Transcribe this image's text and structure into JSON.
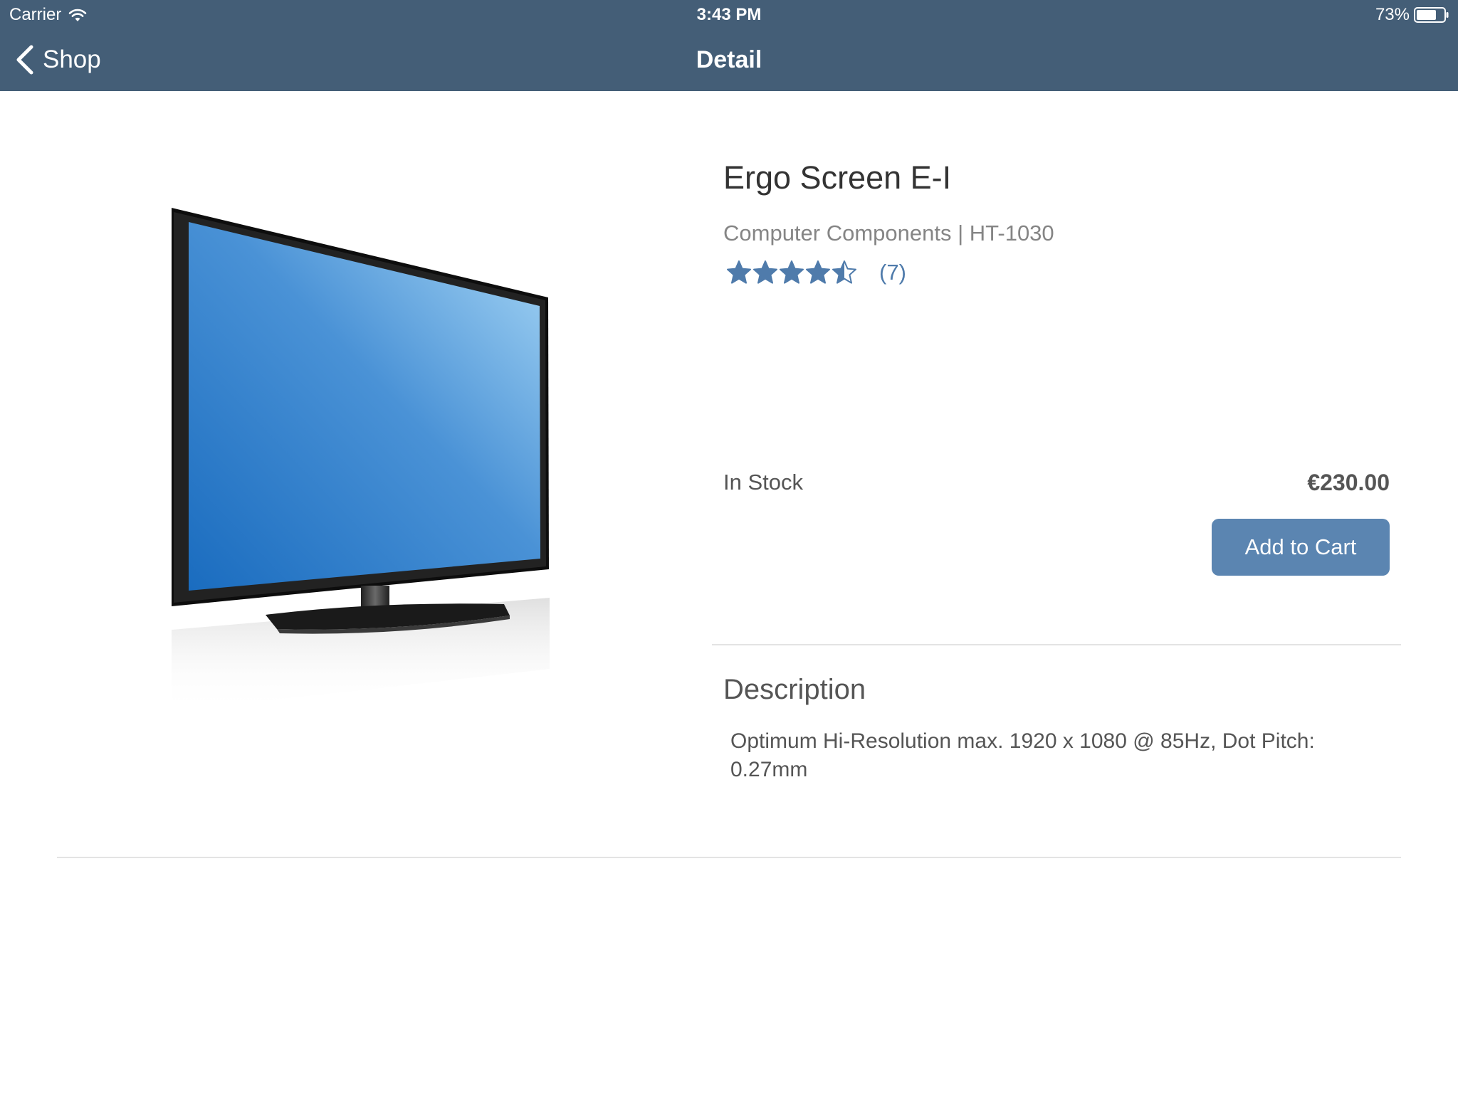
{
  "status_bar": {
    "carrier": "Carrier",
    "time": "3:43 PM",
    "battery": "73%",
    "wifi_icon": "wifi-icon",
    "battery_icon": "battery-icon"
  },
  "nav": {
    "back_label": "Shop",
    "back_icon": "chevron-left-icon",
    "title": "Detail"
  },
  "product": {
    "image_icon": "monitor-image",
    "title": "Ergo Screen E-I",
    "subtitle": "Computer Components | HT-1030",
    "rating_value": 4.5,
    "rating_max": 5,
    "rating_count": "(7)",
    "stock_status": "In Stock",
    "price": "€230.00",
    "add_to_cart_label": "Add to Cart"
  },
  "description": {
    "heading": "Description",
    "body": "Optimum Hi-Resolution max. 1920 x 1080 @ 85Hz, Dot Pitch: 0.27mm"
  },
  "colors": {
    "nav_bar": "#445e77",
    "accent": "#5b85b1",
    "star": "#4f7bab",
    "text_primary": "#333333",
    "text_secondary": "#858585"
  }
}
